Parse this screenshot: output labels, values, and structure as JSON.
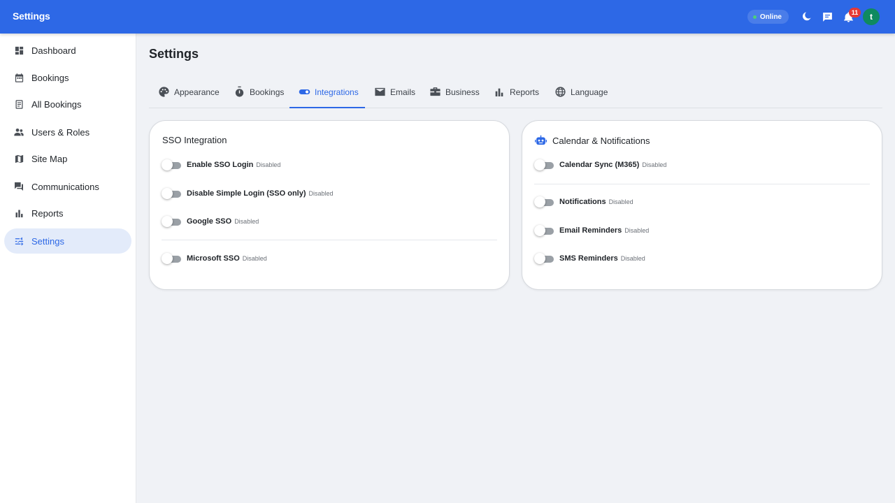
{
  "app": {
    "title": "Settings"
  },
  "appbar": {
    "status": "Online",
    "notification_count": "11",
    "avatar_initial": "t",
    "icons": [
      "moon-icon",
      "chat-icon",
      "bell-icon"
    ]
  },
  "sidebar": {
    "items": [
      {
        "label": "Dashboard",
        "icon": "dashboard-icon"
      },
      {
        "label": "Bookings",
        "icon": "calendar-icon"
      },
      {
        "label": "All Bookings",
        "icon": "book-icon"
      },
      {
        "label": "Users & Roles",
        "icon": "people-icon"
      },
      {
        "label": "Site Map",
        "icon": "map-icon"
      },
      {
        "label": "Communications",
        "icon": "forum-icon"
      },
      {
        "label": "Reports",
        "icon": "bar-chart-icon"
      },
      {
        "label": "Settings",
        "icon": "tune-icon",
        "active": true
      }
    ]
  },
  "main": {
    "title": "Settings",
    "tabs": [
      {
        "label": "Appearance",
        "icon": "palette-icon"
      },
      {
        "label": "Bookings",
        "icon": "timer-icon"
      },
      {
        "label": "Integrations",
        "icon": "toggle-icon",
        "active": true
      },
      {
        "label": "Emails",
        "icon": "mail-icon"
      },
      {
        "label": "Business",
        "icon": "briefcase-icon"
      },
      {
        "label": "Reports",
        "icon": "bar-chart-icon"
      },
      {
        "label": "Language",
        "icon": "globe-icon"
      }
    ]
  },
  "sso_card": {
    "title": "SSO Integration",
    "rows": [
      {
        "label": "Enable SSO Login",
        "state": "Disabled",
        "on": false
      },
      {
        "label": "Disable Simple Login (SSO only)",
        "state": "Disabled",
        "on": false
      },
      {
        "label": "Google SSO",
        "state": "Disabled",
        "on": false
      },
      {
        "label": "Microsoft SSO",
        "state": "Disabled",
        "on": false
      }
    ]
  },
  "calendar_card": {
    "title": "Calendar & Notifications",
    "icon": "robot-icon",
    "rows": [
      {
        "label": "Calendar Sync (M365)",
        "state": "Disabled",
        "on": false
      },
      {
        "label": "Notifications",
        "state": "Disabled",
        "on": false
      },
      {
        "label": "Email Reminders",
        "state": "Disabled",
        "on": false
      },
      {
        "label": "SMS Reminders",
        "state": "Disabled",
        "on": false
      }
    ]
  },
  "colors": {
    "primary": "#2d68e6",
    "status_online": "#4ccf7a",
    "badge": "#e53935",
    "avatar": "#0f8a5f"
  }
}
